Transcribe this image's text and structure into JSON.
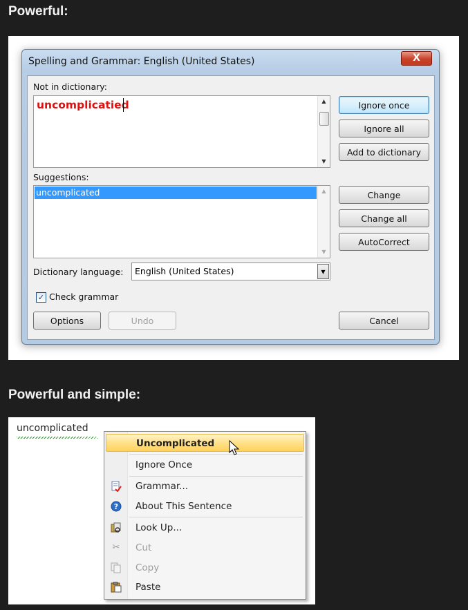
{
  "headings": {
    "first": "Powerful:",
    "second": "Powerful and simple:"
  },
  "dialog": {
    "title": "Spelling and Grammar: English (United States)",
    "close_label": "X",
    "not_in_dictionary_label": "Not in dictionary:",
    "misspelled_word": "uncomplicatied",
    "suggestions_label": "Suggestions:",
    "suggestions": [
      "uncomplicated"
    ],
    "dictionary_language_label": "Dictionary language:",
    "dictionary_language_value": "English (United States)",
    "check_grammar_label": "Check grammar",
    "check_grammar_checked": true,
    "buttons": {
      "ignore_once": "Ignore once",
      "ignore_all": "Ignore all",
      "add_to_dictionary": "Add to dictionary",
      "change": "Change",
      "change_all": "Change all",
      "autocorrect": "AutoCorrect",
      "options": "Options",
      "undo": "Undo",
      "cancel": "Cancel"
    },
    "colors": {
      "misspelled_text": "#e01010",
      "selection": "#3399ff"
    }
  },
  "context_menu": {
    "document_word": "uncomplicated",
    "items": [
      {
        "label": "Uncomplicated",
        "icon": null,
        "bold": true,
        "highlighted": true,
        "enabled": true
      },
      {
        "label": "Ignore Once",
        "icon": null,
        "enabled": true
      },
      {
        "label": "Grammar...",
        "icon": "grammar-icon",
        "enabled": true
      },
      {
        "label": "About This Sentence",
        "icon": "help-icon",
        "enabled": true
      },
      {
        "label": "Look Up...",
        "icon": "research-icon",
        "enabled": true
      },
      {
        "label": "Cut",
        "icon": "scissors-icon",
        "enabled": false
      },
      {
        "label": "Copy",
        "icon": "copy-icon",
        "enabled": false
      },
      {
        "label": "Paste",
        "icon": "clipboard-icon",
        "enabled": true
      }
    ],
    "colors": {
      "highlight": "#ffe08a",
      "squiggle": "#3a8a3a"
    }
  }
}
